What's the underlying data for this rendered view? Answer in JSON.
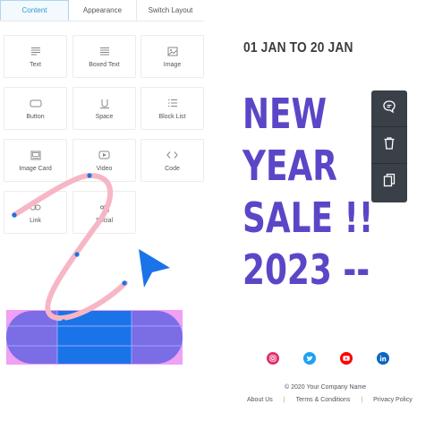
{
  "tabs": [
    {
      "label": "Content"
    },
    {
      "label": "Appearance"
    },
    {
      "label": "Switch Layout"
    }
  ],
  "tiles": [
    {
      "label": "Text",
      "icon": "text-icon"
    },
    {
      "label": "Boxed Text",
      "icon": "boxed-text-icon"
    },
    {
      "label": "Image",
      "icon": "image-icon"
    },
    {
      "label": "Button",
      "icon": "button-icon"
    },
    {
      "label": "Space",
      "icon": "space-icon"
    },
    {
      "label": "Block List",
      "icon": "block-list-icon"
    },
    {
      "label": "Image Card",
      "icon": "image-card-icon"
    },
    {
      "label": "Video",
      "icon": "video-icon"
    },
    {
      "label": "Code",
      "icon": "code-icon"
    },
    {
      "label": "Link",
      "icon": "link-icon"
    },
    {
      "label": "Social",
      "icon": "social-icon"
    }
  ],
  "preview": {
    "date": "01 JAN TO 20 JAN",
    "headline": [
      "NEW",
      "YEAR",
      "SALE !!",
      "2023 --"
    ],
    "copyright": "© 2020 Your Company Name",
    "footer_links": [
      "About Us",
      "Terms & Conditions",
      "Privacy Policy"
    ],
    "footer_separator": "|",
    "socials": [
      {
        "icon": "instagram-icon",
        "color": "#e1306c"
      },
      {
        "icon": "twitter-icon",
        "color": "#1da1f2"
      },
      {
        "icon": "youtube-icon",
        "color": "#ff0000"
      },
      {
        "icon": "linkedin-icon",
        "color": "#0a66c2"
      }
    ]
  },
  "toolbar": {
    "items": [
      {
        "icon": "comment-icon"
      },
      {
        "icon": "trash-icon"
      },
      {
        "icon": "duplicate-icon"
      }
    ]
  },
  "colors": {
    "accent": "#2a9bd8",
    "headline": "#5b46c8",
    "toolbar_bg": "#3a4047",
    "stroke": "#f7b6c6",
    "cursor": "#1a73e8"
  }
}
